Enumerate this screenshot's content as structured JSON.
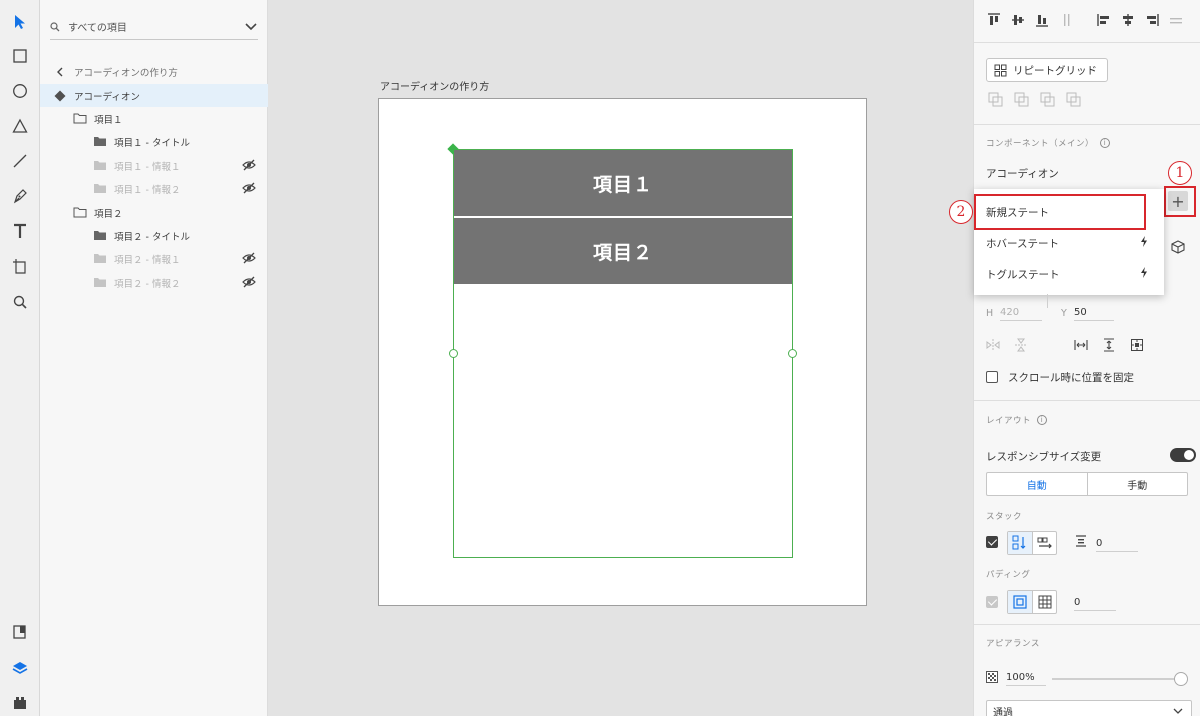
{
  "layers_panel": {
    "search_placeholder": "すべての項目",
    "back_label": "アコーディオンの作り方",
    "items": [
      {
        "label": "アコーディオン"
      },
      {
        "label": "項目１"
      },
      {
        "label": "項目１ - タイトル"
      },
      {
        "label": "項目１ - 情報１"
      },
      {
        "label": "項目１ - 情報２"
      },
      {
        "label": "項目２"
      },
      {
        "label": "項目２ - タイトル"
      },
      {
        "label": "項目２ - 情報１"
      },
      {
        "label": "項目２ - 情報２"
      }
    ]
  },
  "canvas": {
    "artboard_title": "アコーディオンの作り方",
    "rows": [
      "項目１",
      "項目２"
    ]
  },
  "inspector": {
    "repeat_grid_label": "リピートグリッド",
    "component_section_label": "コンポーネント（メイン）",
    "component_name": "アコーディオン",
    "add_state_symbol": "+",
    "state_menu": [
      "新規ステート",
      "ホバーステート",
      "トグルステート"
    ],
    "callout_1": "1",
    "callout_2": "2",
    "h_label": "H",
    "h_value": "420",
    "y_label": "Y",
    "y_value": "50",
    "fix_scroll_label": "スクロール時に位置を固定",
    "layout_section_label": "レイアウト",
    "responsive_label": "レスポンシブサイズ変更",
    "responsive_on": true,
    "seg_auto": "自動",
    "seg_manual": "手動",
    "stack_label": "スタック",
    "stack_spacing": "0",
    "padding_label": "パディング",
    "padding_value": "0",
    "appearance_label": "アピアランス",
    "opacity_value": "100%",
    "blend_mode": "通過"
  },
  "colors": {
    "accent_blue": "#1473e6",
    "selection_green": "#4caf50",
    "annotation_red": "#d8262c",
    "row_fill": "#737373"
  }
}
